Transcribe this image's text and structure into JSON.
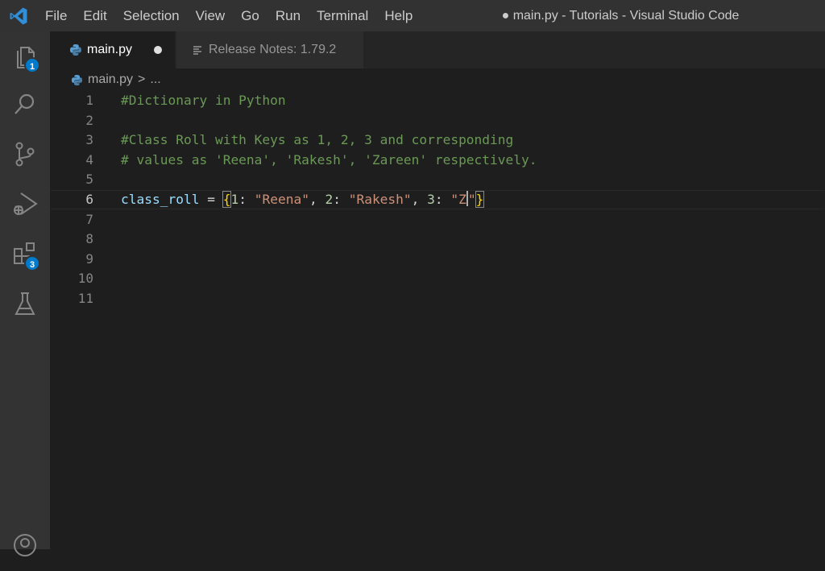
{
  "titlebar": {
    "menu": [
      "File",
      "Edit",
      "Selection",
      "View",
      "Go",
      "Run",
      "Terminal",
      "Help"
    ],
    "window_title": "● main.py - Tutorials - Visual Studio Code",
    "accent_color": "#2f8fd8"
  },
  "activitybar": {
    "items": [
      {
        "icon": "files-icon",
        "badge": "1"
      },
      {
        "icon": "search-icon"
      },
      {
        "icon": "source-control-icon"
      },
      {
        "icon": "run-debug-icon"
      },
      {
        "icon": "extensions-icon",
        "badge": "3"
      },
      {
        "icon": "testing-icon"
      },
      {
        "icon": "accounts-icon"
      }
    ]
  },
  "tabs": [
    {
      "label": "main.py",
      "icon": "python-icon",
      "active": true,
      "dirty": true
    },
    {
      "label": "Release Notes: 1.79.2",
      "icon": "release-notes-icon",
      "active": false
    }
  ],
  "breadcrumb": {
    "file": "main.py",
    "separator": ">",
    "more": "..."
  },
  "editor": {
    "line_numbers": [
      "1",
      "2",
      "3",
      "4",
      "5",
      "6",
      "7",
      "8",
      "9",
      "10",
      "11"
    ],
    "active_line": "6",
    "lines": {
      "l1": "#Dictionary in Python",
      "l3": "#Class Roll with Keys as 1, 2, 3 and corresponding",
      "l4": "# values as 'Reena', 'Rakesh', 'Zareen' respectively.",
      "l6": {
        "var": "class_roll",
        "eq": " = ",
        "open": "{",
        "k1": "1",
        "colon1": ": ",
        "v1": "\"Reena\"",
        "sep1": ", ",
        "k2": "2",
        "colon2": ": ",
        "v2": "\"Rakesh\"",
        "sep2": ", ",
        "k3": "3",
        "colon3": ": ",
        "v3a": "\"Z",
        "v3b": "\"",
        "close": "}"
      }
    }
  }
}
